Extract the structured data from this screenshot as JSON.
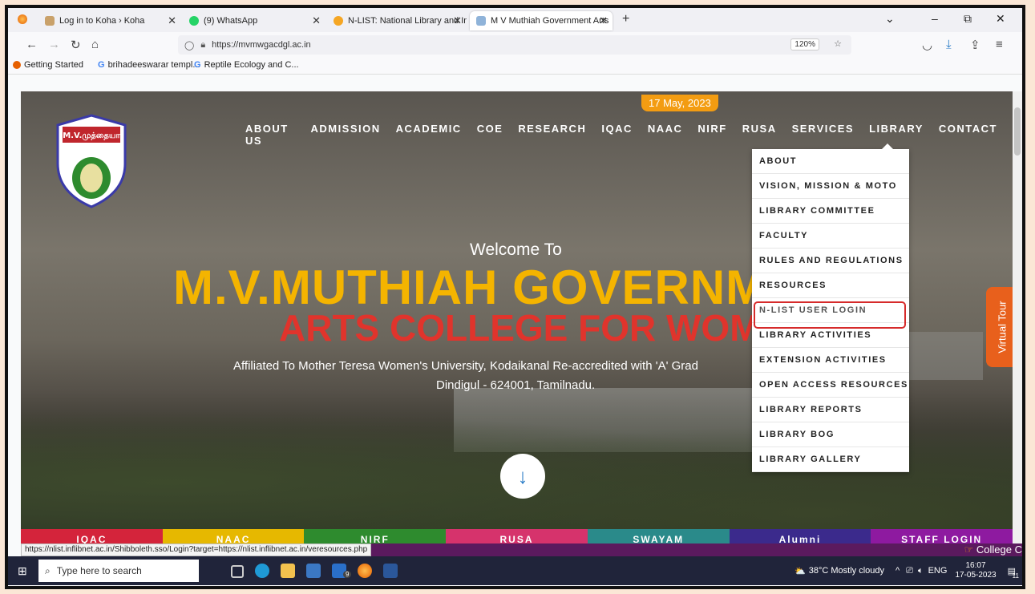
{
  "browser": {
    "tabs": [
      {
        "label": "Log in to Koha › Koha",
        "color": "#c9a16a"
      },
      {
        "label": "(9) WhatsApp",
        "color": "#25d366"
      },
      {
        "label": "N-LIST: National Library and Inf",
        "color": "#f5a623"
      },
      {
        "label": "M V Muthiah Government Arts",
        "color": "#8fb3d9"
      }
    ],
    "new_tab": "+",
    "window_controls": {
      "dropdown": "⌄",
      "minimize": "–",
      "restore": "⧉",
      "close": "✕"
    },
    "url": "https://mvmwgacdgl.ac.in",
    "zoom": "120%",
    "bookmarks": [
      "Getting Started",
      "brihadeeswarar templ...",
      "Reptile Ecology and C..."
    ]
  },
  "site": {
    "date": "17 May, 2023",
    "nav": [
      "ABOUT US",
      "ADMISSION",
      "ACADEMIC",
      "COE",
      "RESEARCH",
      "IQAC",
      "NAAC",
      "NIRF",
      "RUSA",
      "SERVICES",
      "LIBRARY",
      "CONTACT"
    ],
    "library_menu": [
      "ABOUT",
      "VISION, MISSION & MOTO",
      "LIBRARY COMMITTEE",
      "FACULTY",
      "RULES AND REGULATIONS",
      "RESOURCES",
      "N-LIST USER LOGIN",
      "LIBRARY ACTIVITIES",
      "EXTENSION ACTIVITIES",
      "OPEN ACCESS RESOURCES",
      "LIBRARY REPORTS",
      "LIBRARY BOG",
      "LIBRARY GALLERY"
    ],
    "welcome": "Welcome To",
    "title_line1": "M.V.MUTHIAH GOVERNM",
    "title_line2": "ARTS COLLEGE FOR WOME",
    "affiliation": "Affiliated To Mother Teresa Women's University, Kodaikanal Re-accredited with 'A' Grad",
    "address": "Dindigul - 624001, Tamilnadu.",
    "logo_text": "M.V.முத்தையா",
    "virtual_tour": "Virtual Tour",
    "quick_links": [
      {
        "label": "IQAC",
        "color": "#d4243b"
      },
      {
        "label": "NAAC",
        "color": "#e6b800"
      },
      {
        "label": "NIRF",
        "color": "#2e8b2e"
      },
      {
        "label": "RUSA",
        "color": "#d6336c"
      },
      {
        "label": "SWAYAM",
        "color": "#2a8a8a"
      },
      {
        "label": "Alumni",
        "color": "#3b2a8c"
      },
      {
        "label": "STAFF LOGIN",
        "color": "#8e1aa0"
      }
    ],
    "college_tag": "College C",
    "status_url": "https://nlist.inflibnet.ac.in/Shibboleth.sso/Login?target=https://nlist.inflibnet.ac.in/veresources.php"
  },
  "taskbar": {
    "search_placeholder": "Type here to search",
    "weather": "38°C  Mostly cloudy",
    "lang": "ENG",
    "time": "16:07",
    "date": "17-05-2023",
    "notif_badge": "11",
    "mail_badge": "9"
  }
}
